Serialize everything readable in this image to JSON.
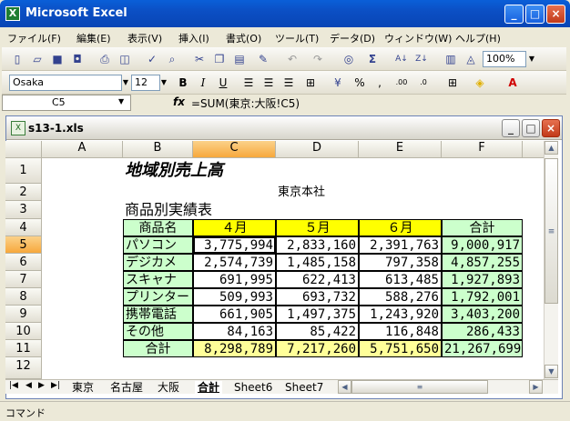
{
  "window": {
    "title": "Microsoft Excel"
  },
  "menu": [
    "ファイル(F)",
    "編集(E)",
    "表示(V)",
    "挿入(I)",
    "書式(O)",
    "ツール(T)",
    "データ(D)",
    "ウィンドウ(W)",
    "ヘルプ(H)"
  ],
  "toolbar": {
    "zoom": "100%"
  },
  "format": {
    "font": "Osaka",
    "size": "12"
  },
  "formula": {
    "namebox": "C5",
    "fx": "fx",
    "text": "=SUM(東京:大阪!C5)"
  },
  "workbook": {
    "title": "s13-1.xls"
  },
  "columns": [
    "A",
    "B",
    "C",
    "D",
    "E",
    "F"
  ],
  "rows": [
    "1",
    "2",
    "3",
    "4",
    "5",
    "6",
    "7",
    "8",
    "9",
    "10",
    "11",
    "12"
  ],
  "sheet": {
    "title": "地域別売上高",
    "office": "東京本社",
    "subtitle": "商品別実績表",
    "headers": [
      "商品名",
      "４月",
      "５月",
      "６月",
      "合計"
    ],
    "data": [
      [
        "パソコン",
        "3,775,994",
        "2,833,160",
        "2,391,763",
        "9,000,917"
      ],
      [
        "デジカメ",
        "2,574,739",
        "1,485,158",
        "797,358",
        "4,857,255"
      ],
      [
        "スキャナ",
        "691,995",
        "622,413",
        "613,485",
        "1,927,893"
      ],
      [
        "プリンター",
        "509,993",
        "693,732",
        "588,276",
        "1,792,001"
      ],
      [
        "携帯電話",
        "661,905",
        "1,497,375",
        "1,243,920",
        "3,403,200"
      ],
      [
        "その他",
        "84,163",
        "85,422",
        "116,848",
        "286,433"
      ]
    ],
    "total": [
      "合計",
      "8,298,789",
      "7,217,260",
      "5,751,650",
      "21,267,699"
    ]
  },
  "tabs": [
    "東京",
    "名古屋",
    "大阪",
    "合計",
    "Sheet6",
    "Sheet7"
  ],
  "status": "コマンド"
}
